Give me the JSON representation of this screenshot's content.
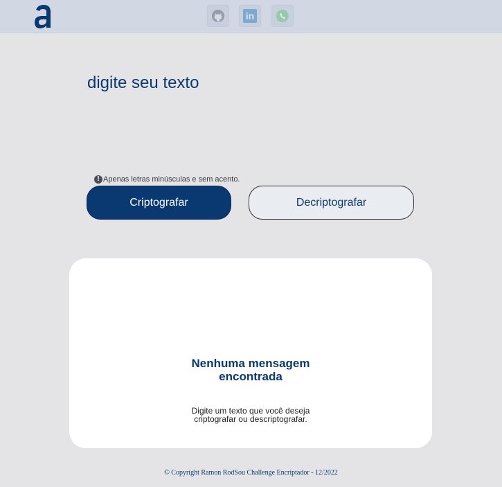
{
  "header": {
    "logo_letter": "a",
    "social": [
      {
        "name": "github",
        "icon": "github-icon"
      },
      {
        "name": "linkedin",
        "icon": "linkedin-icon",
        "glyph": "in"
      },
      {
        "name": "whatsapp",
        "icon": "whatsapp-icon"
      }
    ]
  },
  "input": {
    "placeholder": "digite seu texto",
    "value": ""
  },
  "hint": {
    "icon_glyph": "!",
    "text": "Apenas letras minúsculas e sem acento."
  },
  "buttons": {
    "encrypt_label": "Criptografar",
    "decrypt_label": "Decriptografar"
  },
  "output": {
    "title_line1": "Nenhuma mensagem",
    "title_line2": "encontrada",
    "subtitle_line1": "Digite um texto que você deseja",
    "subtitle_line2": "criptografar ou descriptografar."
  },
  "footer": {
    "text": "© Copyright Ramon RodSou Challenge Encriptador - 12/2022"
  },
  "colors": {
    "primary": "#0a3871",
    "background": "#e4e4e6",
    "header": "#d2d8e3",
    "card": "#ffffff"
  }
}
